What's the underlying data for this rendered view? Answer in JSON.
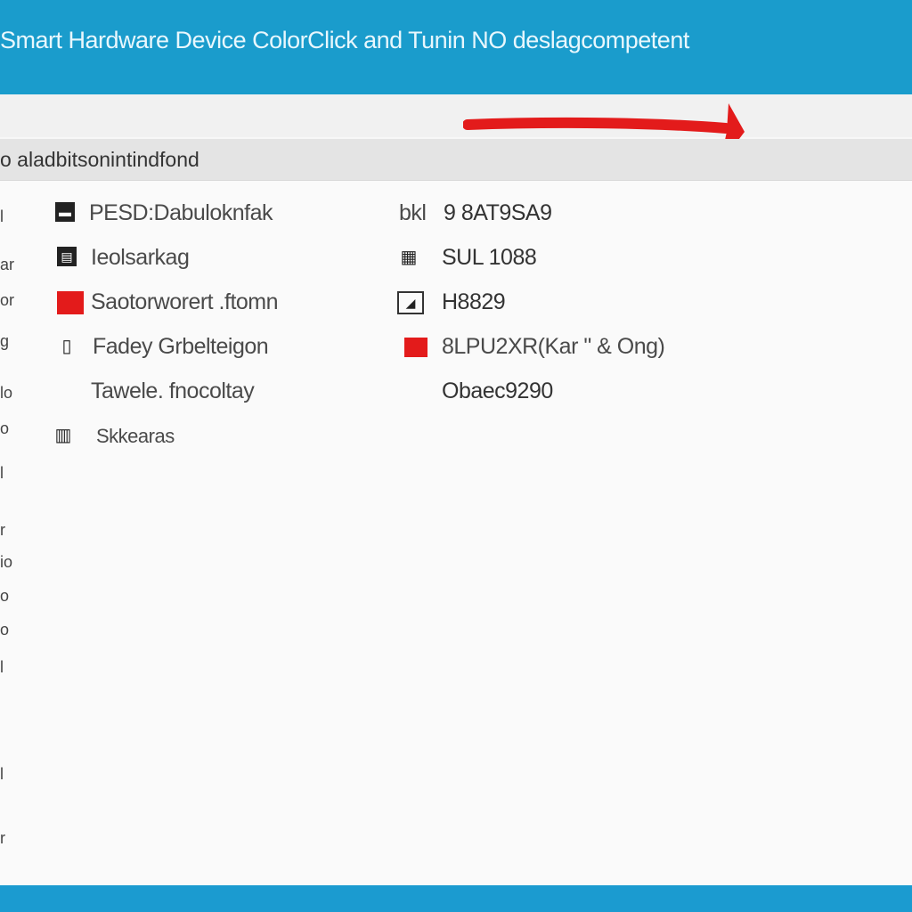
{
  "window": {
    "title": "Smart Hardware Device ColorClick and Tunin NO deslagcompetent"
  },
  "section": {
    "title": "o aladbitsonintindfond"
  },
  "sidebar_marks": [
    "l",
    "ar",
    "or",
    "g",
    "lo",
    "o",
    "l",
    "r",
    "io",
    "o",
    "o",
    "l",
    "l",
    "r"
  ],
  "left_items": [
    {
      "icon": "document-icon",
      "label": "PESD:Dabuloknfak"
    },
    {
      "icon": "card-icon",
      "label": "Ieolsarkag"
    },
    {
      "icon": "red-square-icon",
      "label": "Saotorworert .ftomn"
    },
    {
      "icon": "phone-icon",
      "label": "Fadey Grbelteigon"
    },
    {
      "icon": "",
      "label": "Tawele. fnocoltay"
    },
    {
      "icon": "sim-icon",
      "label": "Skkearas"
    }
  ],
  "right_items": [
    {
      "icon": "chip-icon",
      "label": "bkl",
      "value": "9 8AT9SA9"
    },
    {
      "icon": "memory-icon",
      "label": "",
      "value": "SUL 1088"
    },
    {
      "icon": "image-icon",
      "label": "",
      "value": "H8829"
    },
    {
      "icon": "red-square-icon",
      "label": "",
      "value": "8LPU2XR(Kar \" & Ong)"
    },
    {
      "icon": "",
      "label": "",
      "value": "Obaec9290"
    }
  ],
  "colors": {
    "title_bar": "#1a9ccc",
    "accent_red": "#e31b1b",
    "header_band": "#e4e4e4"
  }
}
